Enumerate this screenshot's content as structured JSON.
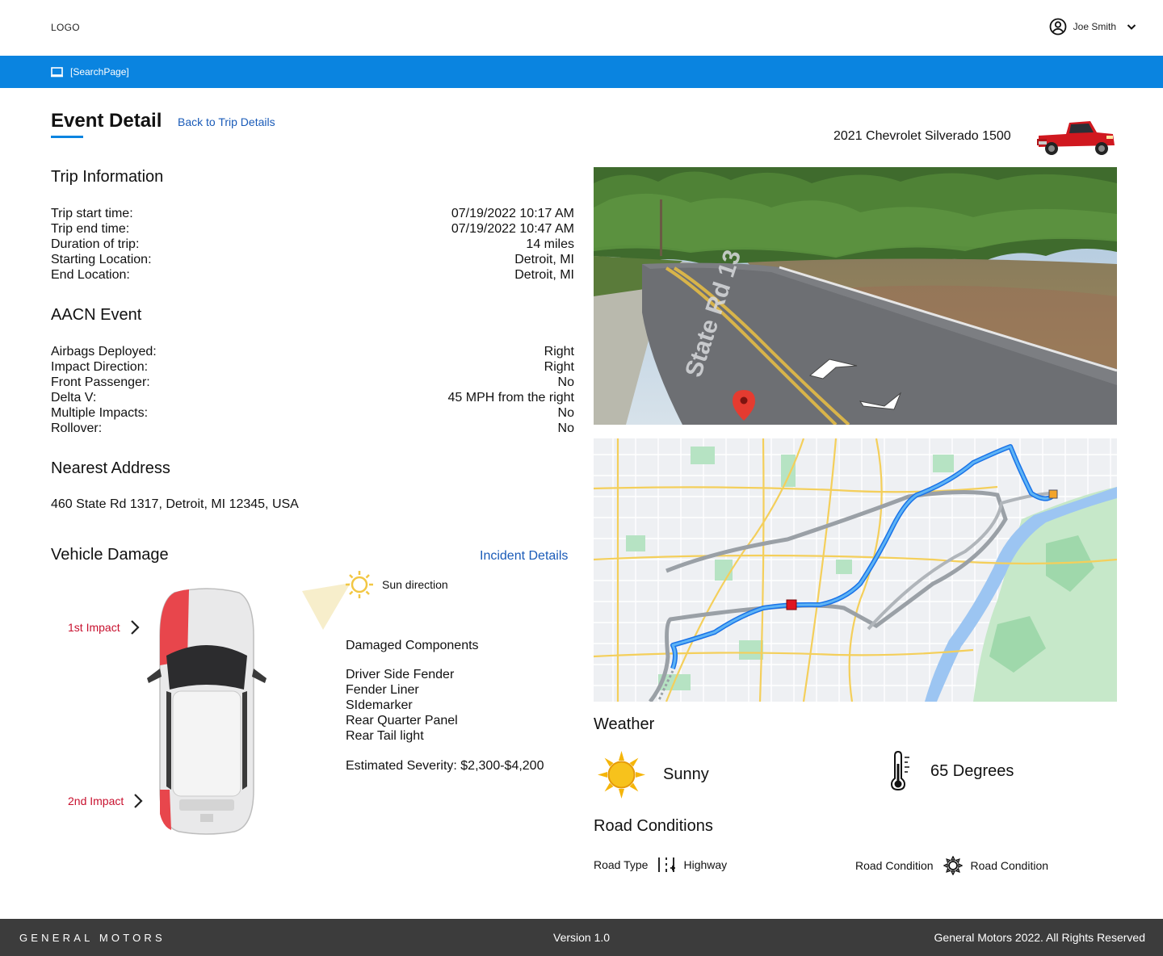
{
  "header": {
    "logo": "LOGO",
    "user_name": "Joe Smith"
  },
  "breadcrumb": {
    "label": "[SearchPage]"
  },
  "page": {
    "title": "Event Detail",
    "back_link": "Back to Trip Details",
    "vehicle": "2021 Chevrolet Silverado 1500"
  },
  "trip": {
    "title": "Trip Information",
    "rows": [
      {
        "label": "Trip start time:",
        "value": "07/19/2022 10:17 AM"
      },
      {
        "label": "Trip end time:",
        "value": "07/19/2022 10:47 AM"
      },
      {
        "label": "Duration of trip:",
        "value": "14 miles"
      },
      {
        "label": "Starting Location:",
        "value": "Detroit, MI"
      },
      {
        "label": "End Location:",
        "value": "Detroit, MI"
      }
    ]
  },
  "aacn": {
    "title": "AACN Event",
    "rows": [
      {
        "label": "Airbags Deployed:",
        "value": "Right"
      },
      {
        "label": "Impact Direction:",
        "value": "Right"
      },
      {
        "label": "Front Passenger:",
        "value": "No"
      },
      {
        "label": "Delta V:",
        "value": "45 MPH from the right"
      },
      {
        "label": "Multiple Impacts:",
        "value": "No"
      },
      {
        "label": "Rollover:",
        "value": "No"
      }
    ]
  },
  "address": {
    "title": "Nearest Address",
    "value": "460 State Rd 1317, Detroit, MI 12345, USA"
  },
  "damage": {
    "title": "Vehicle Damage",
    "incident_link": "Incident Details",
    "impact1": "1st Impact",
    "impact2": "2nd Impact",
    "sun_direction": "Sun direction",
    "components_title": "Damaged Components",
    "components": [
      "Driver Side Fender",
      "Fender Liner",
      "SIdemarker",
      "Rear Quarter Panel",
      "Rear Tail light"
    ],
    "severity": "Estimated Severity: $2,300-$4,200"
  },
  "street_view": {
    "road_sign": "State Rd 13"
  },
  "weather": {
    "title": "Weather",
    "condition": "Sunny",
    "condition_icon": "sun-icon",
    "temperature": "65 Degrees",
    "temperature_icon": "thermometer-icon"
  },
  "road": {
    "title": "Road Conditions",
    "type_label": "Road Type",
    "type_value": "Highway",
    "condition_label": "Road Condition",
    "condition_value": "Road Condition"
  },
  "footer": {
    "brand": "GENERAL MOTORS",
    "version": "Version 1.0",
    "rights": "General Motors 2022. All Rights Reserved"
  },
  "colors": {
    "accent": "#0A84E0",
    "link": "#1a5bb8",
    "impact": "#c8102e",
    "footer": "#3c3c3c"
  }
}
